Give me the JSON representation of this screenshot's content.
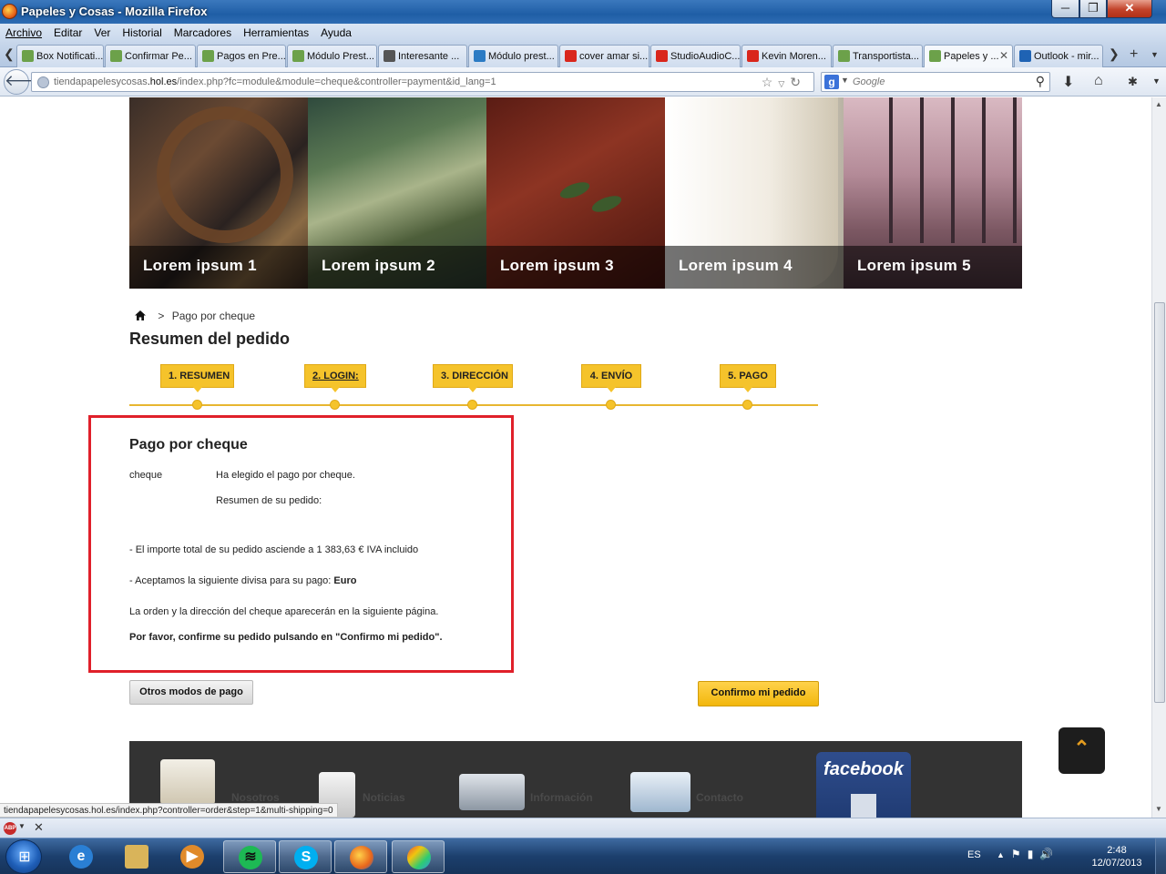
{
  "window": {
    "title": "Papeles y Cosas - Mozilla Firefox",
    "min": "─",
    "max": "❐",
    "close": "✕"
  },
  "menu": [
    "Archivo",
    "Editar",
    "Ver",
    "Historial",
    "Marcadores",
    "Herramientas",
    "Ayuda"
  ],
  "tabs": [
    {
      "label": "Box Notificati...",
      "color": "#6ca14a"
    },
    {
      "label": "Confirmar Pe...",
      "color": "#6ca14a"
    },
    {
      "label": "Pagos en Pre...",
      "color": "#6ca14a"
    },
    {
      "label": "Módulo Prest...",
      "color": "#6ca14a"
    },
    {
      "label": "Interesante ...",
      "color": "#555555"
    },
    {
      "label": "Módulo prest...",
      "color": "#2b7bc4"
    },
    {
      "label": "cover amar si...",
      "color": "#d9261c"
    },
    {
      "label": "StudioAudioC...",
      "color": "#d9261c"
    },
    {
      "label": "Kevin Moren...",
      "color": "#d9261c"
    },
    {
      "label": "Transportista...",
      "color": "#6ca14a"
    },
    {
      "label": "Papeles y ...",
      "color": "#6ca14a",
      "active": true
    },
    {
      "label": "Outlook - mir...",
      "color": "#1f63b4"
    }
  ],
  "nav": {
    "url_host": "tiendapapelesycosas",
    "url_domain": ".hol.es",
    "url_path": "/index.php?fc=module&module=cheque&controller=payment&id_lang=1",
    "search_placeholder": "Google",
    "search_engine": "g"
  },
  "banner": [
    "Lorem ipsum 1",
    "Lorem ipsum 2",
    "Lorem ipsum 3",
    "Lorem ipsum 4",
    "Lorem ipsum 5"
  ],
  "breadcrumb": {
    "sep": ">",
    "current": "Pago por cheque"
  },
  "page_title": "Resumen del pedido",
  "steps": [
    "1. RESUMEN",
    "2. LOGIN:",
    "3. DIRECCIÓN",
    "4. ENVÍO",
    "5. PAGO"
  ],
  "payment": {
    "title": "Pago por cheque",
    "method": "cheque",
    "chosen": "Ha elegido el pago por cheque.",
    "summary_label": "Resumen de su pedido:",
    "total_line": "- El importe total de su pedido asciende a 1 383,63 € IVA incluido",
    "currency_line": "- Aceptamos la siguiente divisa para su pago: ",
    "currency": "Euro",
    "next_page": "La orden y la dirección del cheque aparecerán en la siguiente página.",
    "confirm_prompt": "Por favor, confirme su pedido pulsando en \"Confirmo mi pedido\"."
  },
  "buttons": {
    "other": "Otros modos de pago",
    "confirm": "Confirmo mi pedido"
  },
  "footer": {
    "items": [
      "Nosotros",
      "Noticias",
      "Información",
      "Contacto"
    ],
    "facebook": "facebook"
  },
  "to_top": "⌃",
  "status_link": "tiendapapelesycosas.hol.es/index.php?controller=order&step=1&multi-shipping=0",
  "taskbar": {
    "lang": "ES",
    "time": "2:48",
    "date": "12/07/2013"
  }
}
